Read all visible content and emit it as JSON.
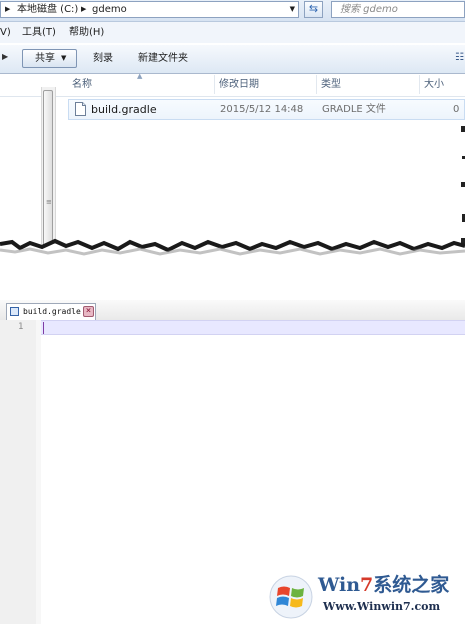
{
  "explorer": {
    "address": {
      "drive": "本地磁盘 (C:)",
      "folder": "gdemo"
    },
    "search_placeholder": "搜索 gdemo",
    "menu": {
      "view_fragment": "V)",
      "tools": "工具(T)",
      "help": "帮助(H)"
    },
    "toolbar": {
      "share": "共享",
      "burn": "刻录",
      "new_folder": "新建文件夹"
    },
    "columns": {
      "name": "名称",
      "date": "修改日期",
      "type": "类型",
      "size": "大小"
    },
    "files": [
      {
        "name": "build.gradle",
        "date": "2015/5/12 14:48",
        "type": "GRADLE 文件",
        "size": "0"
      }
    ]
  },
  "editor": {
    "tab_label": "build.gradle",
    "line_numbers": [
      "1"
    ]
  },
  "watermark": {
    "brand_win": "Win",
    "brand_seven": "7",
    "brand_tail": "系统之家",
    "url": "Www.Winwin7.com"
  },
  "colors": {
    "explorer_chrome": "#dde8f4",
    "current_line": "#e8e8ff",
    "brand_blue": "#2f5a92",
    "brand_red": "#d63a2a"
  }
}
